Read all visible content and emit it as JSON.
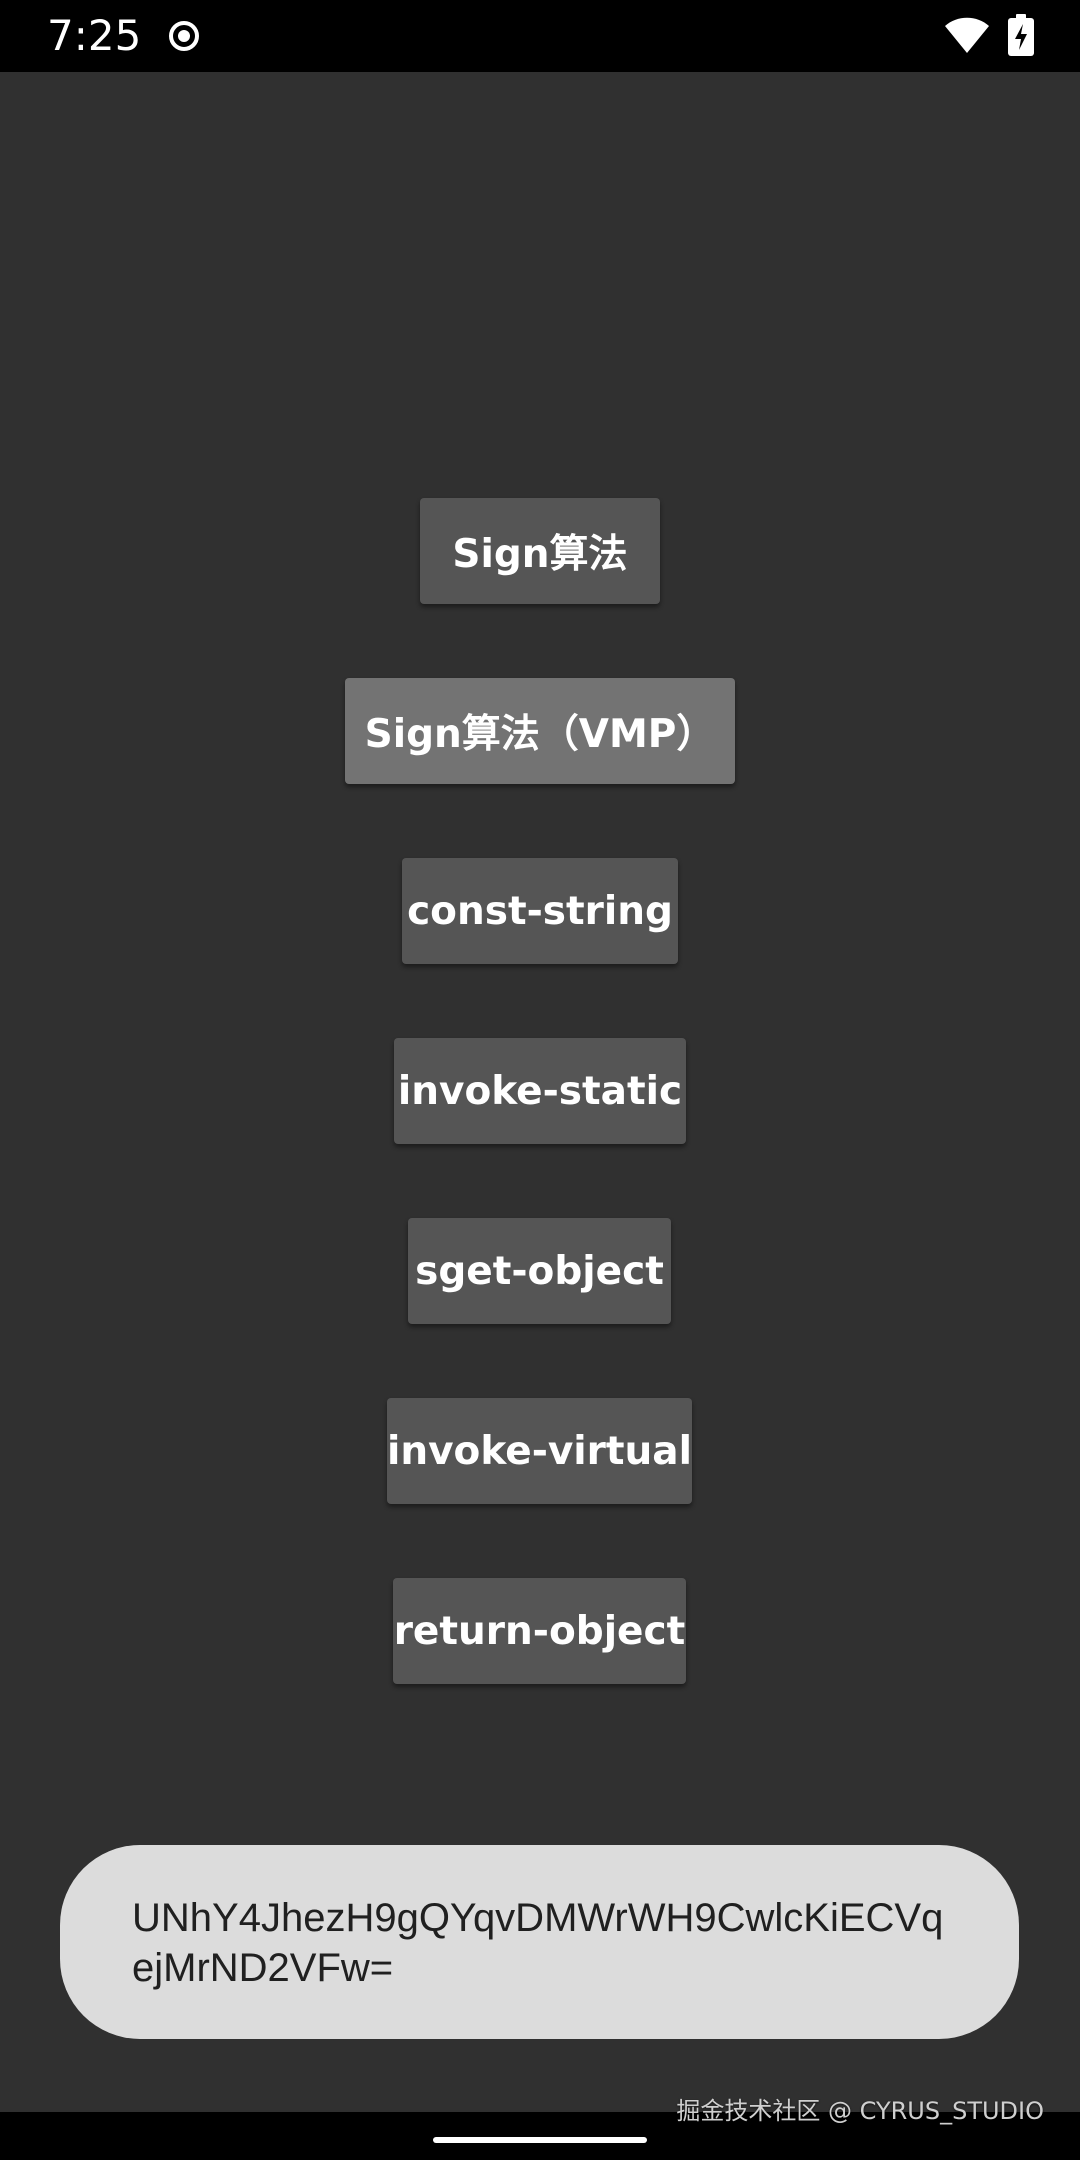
{
  "status_bar": {
    "time": "7:25",
    "icons": [
      "record-icon",
      "wifi-icon",
      "battery-charging-icon"
    ]
  },
  "buttons": [
    {
      "label": "Sign算法"
    },
    {
      "label": "Sign算法（VMP）"
    },
    {
      "label": "const-string"
    },
    {
      "label": "invoke-static"
    },
    {
      "label": "sget-object"
    },
    {
      "label": "invoke-virtual"
    },
    {
      "label": "return-object"
    }
  ],
  "toast": {
    "text": "UNhY4JhezH9gQYqvDMWrWH9CwlcKiECVqejMrND2VFw="
  },
  "watermark": "掘金技术社区 @ CYRUS_STUDIO",
  "colors": {
    "background": "#303030",
    "button": "#555555",
    "button_pressed": "#737373",
    "toast_background": "#dcdcdc",
    "system_bars": "#000000"
  }
}
